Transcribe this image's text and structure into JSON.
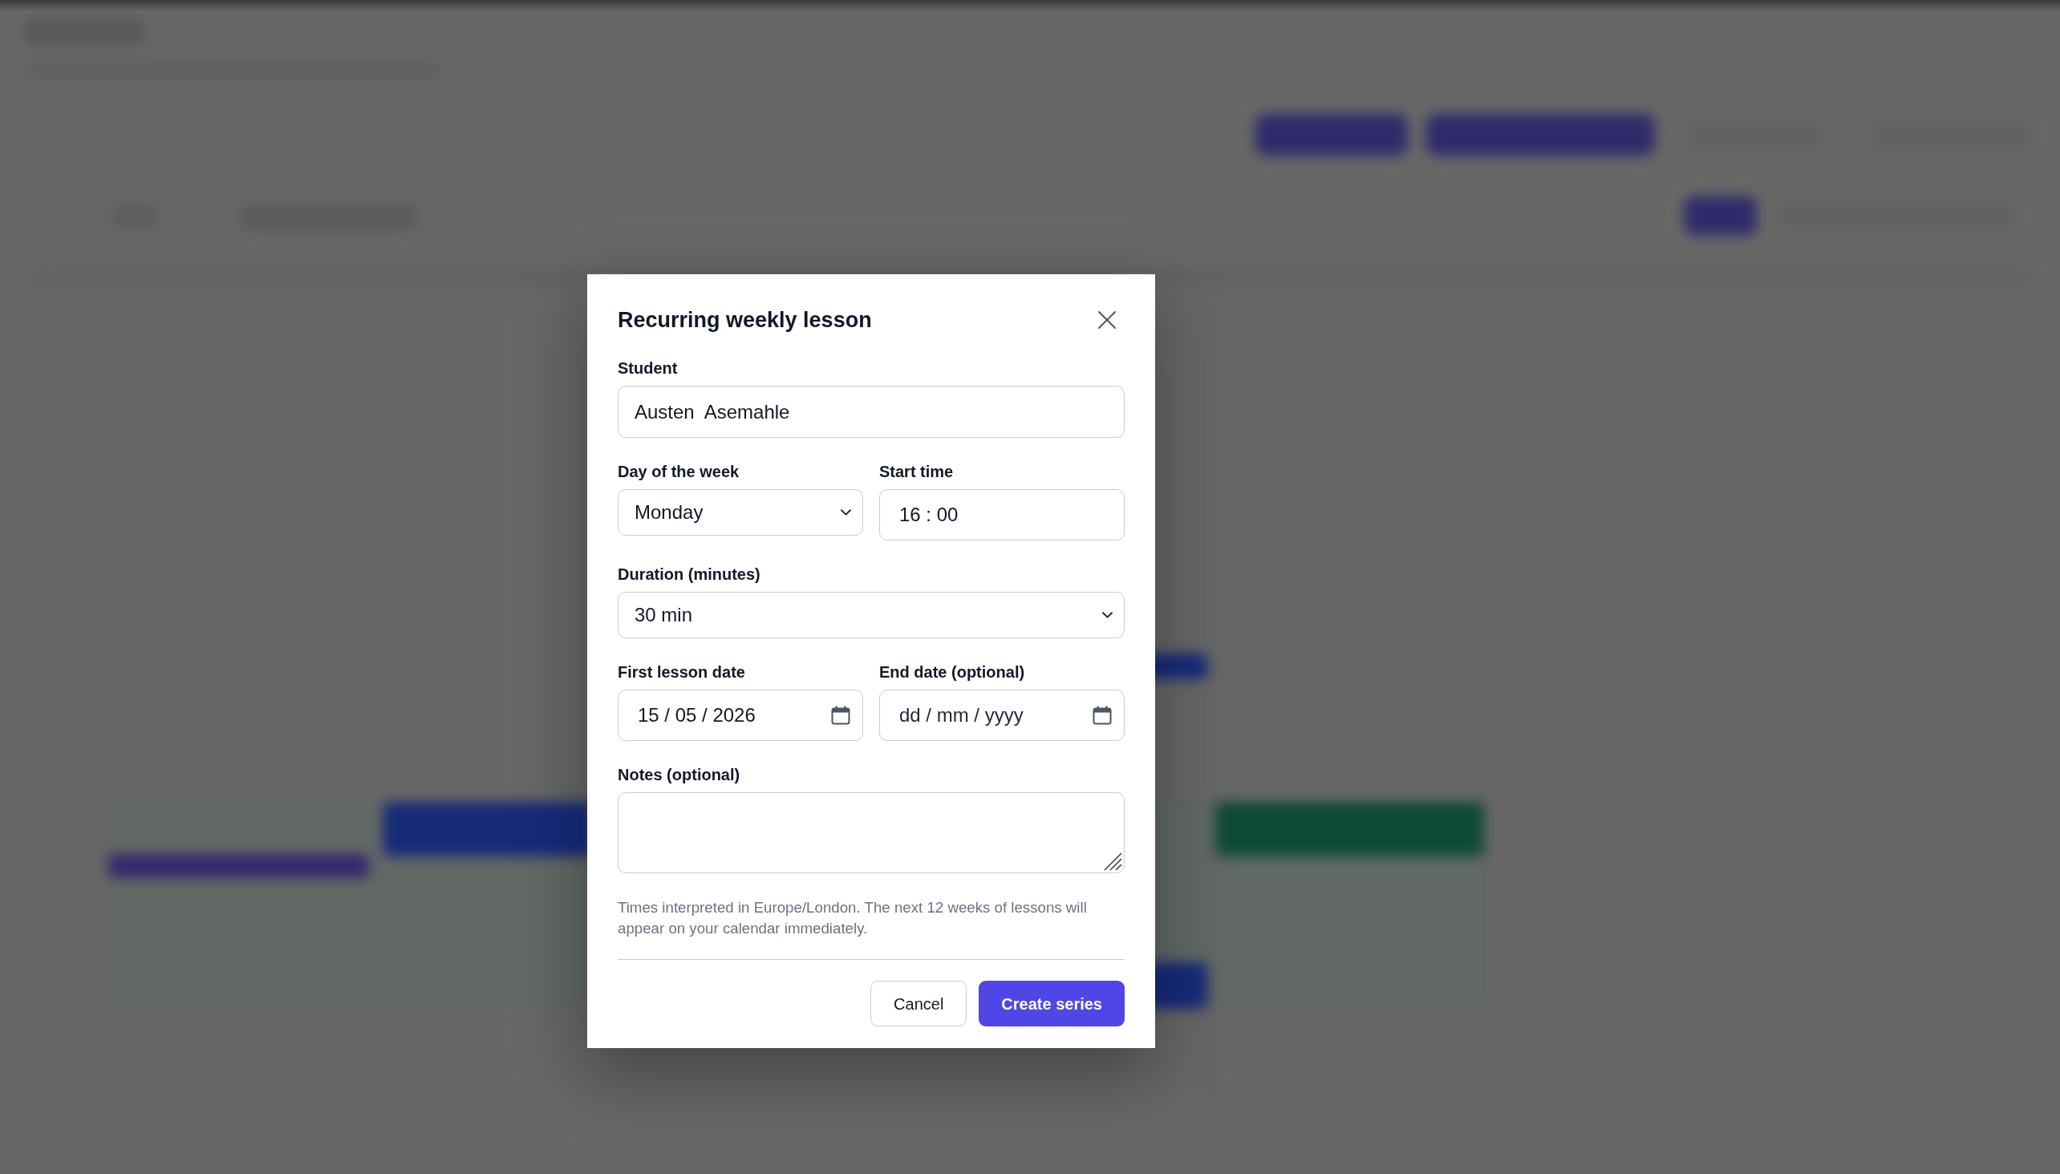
{
  "dialog": {
    "title": "Recurring weekly lesson",
    "rows": [
      [
        {
          "kind": "text",
          "label": "Student",
          "value": "Austen  Asemahle"
        }
      ],
      [
        {
          "kind": "select",
          "label": "Day of the week",
          "value": "Monday"
        },
        {
          "kind": "time",
          "label": "Start time",
          "value": "16 : 00"
        }
      ],
      [
        {
          "kind": "select",
          "label": "Duration (minutes)",
          "value": "30 min"
        }
      ],
      [
        {
          "kind": "date",
          "label": "First lesson date",
          "value": "15 / 05 / 2026"
        },
        {
          "kind": "date",
          "label": "End date (optional)",
          "placeholder": "dd / mm / yyyy"
        }
      ],
      [
        {
          "kind": "textarea",
          "label": "Notes (optional)"
        }
      ]
    ],
    "note": "Times interpreted in Europe/London. The next 12 weeks of lessons will appear on your calendar immediately.",
    "buttons": [
      {
        "kind": "secondary",
        "label": "Cancel"
      },
      {
        "kind": "primary",
        "label": "Create series"
      }
    ]
  }
}
